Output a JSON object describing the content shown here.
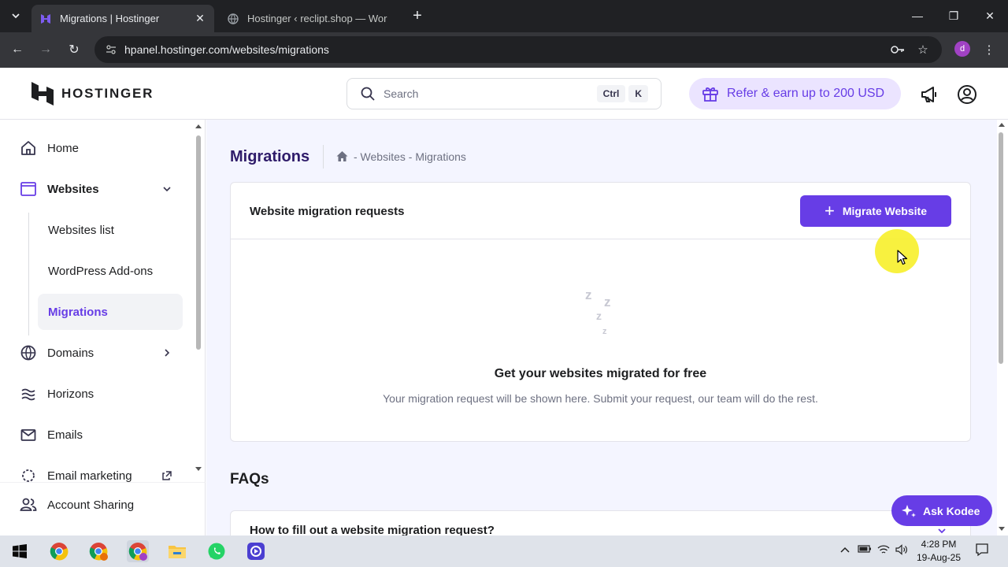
{
  "browser": {
    "tabs": [
      {
        "title": "Migrations | Hostinger",
        "active": true
      },
      {
        "title": "Hostinger ‹ reclipt.shop — Wor",
        "active": false
      }
    ],
    "url": "hpanel.hostinger.com/websites/migrations",
    "profile_initial": "d"
  },
  "header": {
    "logo_text": "HOSTINGER",
    "search_placeholder": "Search",
    "shortcut_key1": "Ctrl",
    "shortcut_key2": "K",
    "refer_label": "Refer & earn up to 200 USD"
  },
  "sidebar": {
    "items": [
      {
        "label": "Home",
        "icon": "home-icon"
      },
      {
        "label": "Websites",
        "icon": "browser-window-icon"
      },
      {
        "label": "Domains",
        "icon": "globe-icon"
      },
      {
        "label": "Horizons",
        "icon": "horizons-icon"
      },
      {
        "label": "Emails",
        "icon": "mail-icon"
      },
      {
        "label": "Email marketing",
        "icon": "email-marketing-icon"
      },
      {
        "label": "Account Sharing",
        "icon": "users-icon"
      }
    ],
    "sub_items": [
      "Websites list",
      "WordPress Add-ons",
      "Migrations"
    ]
  },
  "main": {
    "page_title": "Migrations",
    "breadcrumb": "- Websites - Migrations",
    "card_title": "Website migration requests",
    "migrate_button": "Migrate Website",
    "empty_title": "Get your websites migrated for free",
    "empty_desc": "Your migration request will be shown here. Submit your request, our team will do the rest.",
    "faqs_title": "FAQs",
    "faq_question": "How to fill out a website migration request?"
  },
  "ask_kodee": "Ask Kodee",
  "taskbar": {
    "time": "4:28 PM",
    "date": "19-Aug-25"
  },
  "colors": {
    "brand": "#673de6",
    "brand_light": "#ebe4ff",
    "text_dark": "#1d1e20",
    "muted": "#6d7081"
  }
}
